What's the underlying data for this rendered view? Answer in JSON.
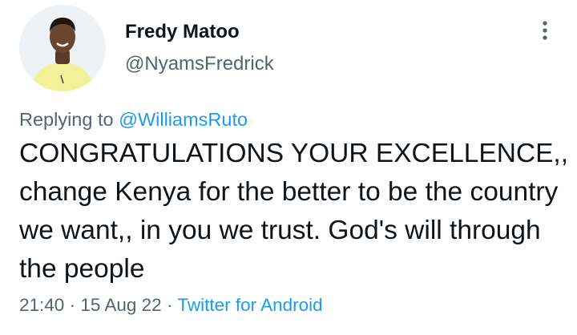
{
  "author": {
    "display_name": "Fredy Matoo",
    "handle": "@NyamsFredrick",
    "avatar_icon": "profile-photo"
  },
  "header": {
    "more_icon": "more-vertical-icon"
  },
  "reply": {
    "prefix": "Replying to",
    "mention": "@WilliamsRuto"
  },
  "tweet": {
    "text": "CONGRATULATIONS YOUR EXCELLENCE,, change Kenya for the better to be the country we want,, in you we trust. God's will through the people"
  },
  "meta": {
    "time": "21:40",
    "separator1": "·",
    "date": "15 Aug 22",
    "separator2": "·",
    "source": "Twitter for Android"
  },
  "colors": {
    "text": "#0f1419",
    "secondary": "#536471",
    "link": "#1d9bf0"
  }
}
